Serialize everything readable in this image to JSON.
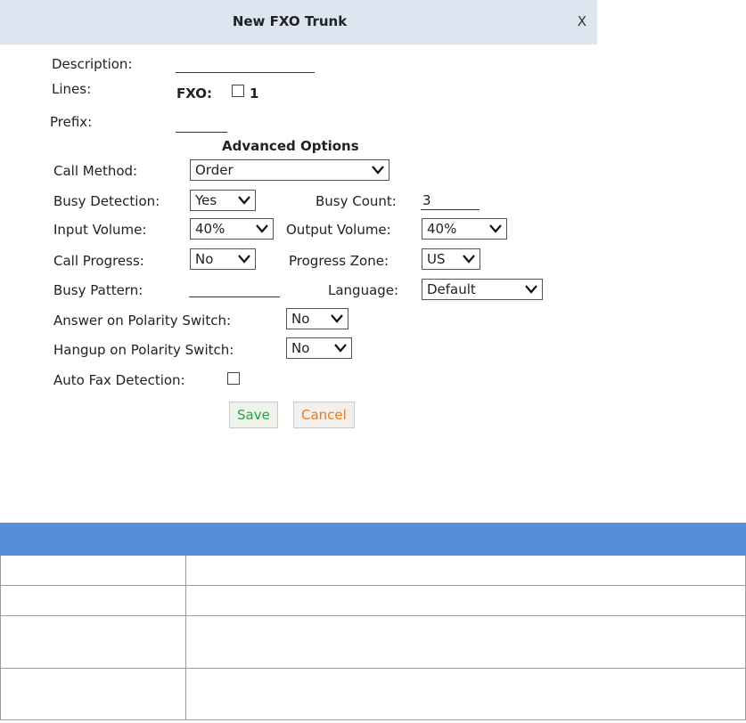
{
  "dialog": {
    "title": "New FXO Trunk",
    "close_label": "X"
  },
  "form": {
    "description_label": "Description:",
    "description_value": "",
    "lines_label": "Lines:",
    "fxo_label": "FXO:",
    "fxo_line_number": "1",
    "fxo_line_checked": false,
    "prefix_label": "Prefix:",
    "prefix_value": "",
    "advanced_heading": "Advanced Options",
    "call_method_label": "Call Method:",
    "call_method_value": "Order",
    "busy_detection_label": "Busy Detection:",
    "busy_detection_value": "Yes",
    "busy_count_label": "Busy Count:",
    "busy_count_value": "3",
    "input_volume_label": "Input Volume:",
    "input_volume_value": "40%",
    "output_volume_label": "Output Volume:",
    "output_volume_value": "40%",
    "call_progress_label": "Call Progress:",
    "call_progress_value": "No",
    "progress_zone_label": "Progress Zone:",
    "progress_zone_value": "US",
    "busy_pattern_label": "Busy Pattern:",
    "busy_pattern_value": "",
    "language_label": "Language:",
    "language_value": "Default",
    "answer_polarity_label": "Answer on Polarity Switch:",
    "answer_polarity_value": "No",
    "hangup_polarity_label": "Hangup on Polarity Switch:",
    "hangup_polarity_value": "No",
    "auto_fax_label": "Auto Fax Detection:",
    "auto_fax_checked": false
  },
  "buttons": {
    "save_label": "Save",
    "cancel_label": "Cancel"
  },
  "colors": {
    "titlebar_bg": "#dbe6f1",
    "table_header_bg": "#558fdc",
    "save_text": "#2aa040",
    "cancel_text": "#ea7a1a"
  },
  "param_table": {
    "headers": [
      "",
      ""
    ],
    "rows": [
      [
        "",
        ""
      ],
      [
        "",
        ""
      ],
      [
        "",
        ""
      ],
      [
        "",
        ""
      ]
    ]
  }
}
